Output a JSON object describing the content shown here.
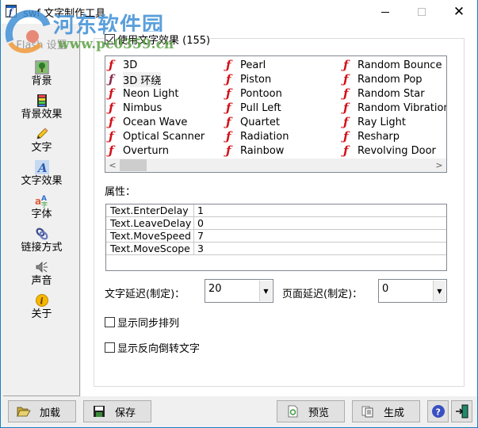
{
  "window": {
    "title": "swf 文字制作工具",
    "controls": [
      "minimize",
      "maximize",
      "close"
    ]
  },
  "watermark": {
    "brand": "河东软件园",
    "url": "www.pc0359.cn"
  },
  "sidebar": {
    "items": [
      {
        "label": "Flash 设置",
        "icon": "flash-settings-icon"
      },
      {
        "label": "背景",
        "icon": "background-image-icon"
      },
      {
        "label": "背景效果",
        "icon": "film-strip-icon"
      },
      {
        "label": "文字",
        "icon": "pencil-icon"
      },
      {
        "label": "文字效果",
        "icon": "text-effect-icon",
        "selected": true
      },
      {
        "label": "字体",
        "icon": "font-icon"
      },
      {
        "label": "链接方式",
        "icon": "link-icon"
      },
      {
        "label": "声音",
        "icon": "speaker-icon"
      },
      {
        "label": "关于",
        "icon": "info-icon"
      }
    ]
  },
  "main": {
    "use_effect_checkbox": {
      "label": "使用文字效果 (155)",
      "checked": true
    },
    "effects": {
      "columns": [
        [
          "3D",
          "3D 环绕",
          "Neon Light",
          "Nimbus",
          "Ocean Wave",
          "Optical Scanner",
          "Overturn"
        ],
        [
          "Pearl",
          "Piston",
          "Pontoon",
          "Pull Left",
          "Quartet",
          "Radiation",
          "Rainbow"
        ],
        [
          "Random Bounce",
          "Random Pop",
          "Random Star",
          "Random Vibration",
          "Ray Light",
          "Resharp",
          "Revolving Door"
        ]
      ],
      "selected": "3D 环绕",
      "scroll_left": "<",
      "scroll_right": ">"
    },
    "properties_label": "属性：",
    "properties": [
      {
        "key": "Text.EnterDelay",
        "value": "1"
      },
      {
        "key": "Text.LeaveDelay",
        "value": "0"
      },
      {
        "key": "Text.MoveSpeed",
        "value": "7"
      },
      {
        "key": "Text.MoveScope",
        "value": "3"
      }
    ],
    "text_delay": {
      "label": "文字延迟(制定)：",
      "value": "20"
    },
    "page_delay": {
      "label": "页面延迟(制定)：",
      "value": "0"
    },
    "show_sync": {
      "label": "显示同步排列",
      "checked": false
    },
    "show_reverse": {
      "label": "显示反向倒转文字",
      "checked": false
    }
  },
  "footer": {
    "load": "加载",
    "save": "保存",
    "preview": "预览",
    "generate": "生成"
  },
  "colors": {
    "flash_icon": "#d3121a",
    "window_border": "#1a7fc1",
    "watermark_blue": "#4a95d8",
    "watermark_green": "#5aa043"
  }
}
